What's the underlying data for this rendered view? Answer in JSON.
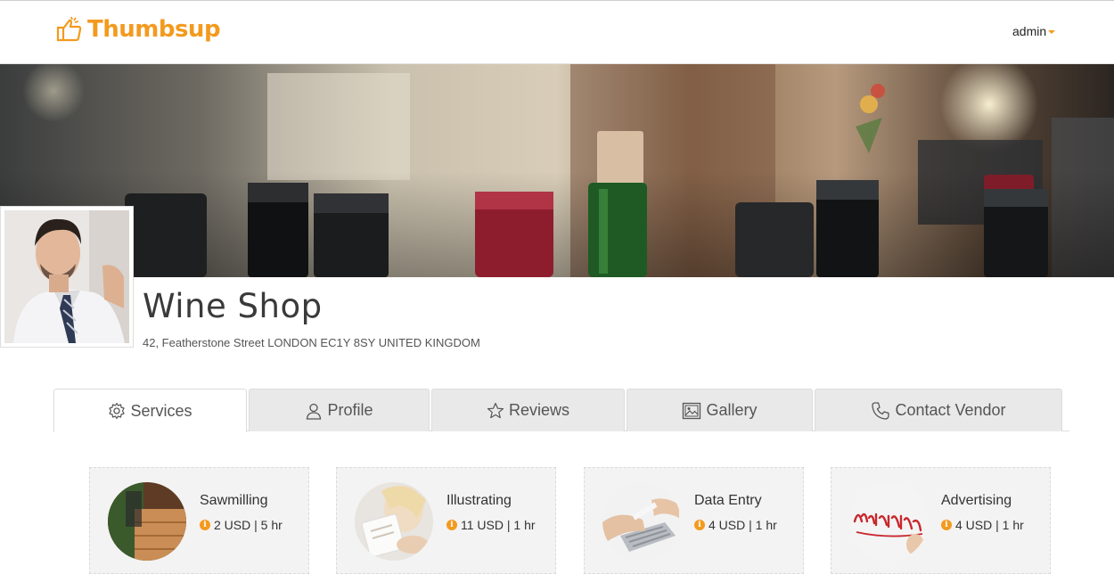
{
  "brand": {
    "name": "Thumbsup",
    "color": "#f39a1e"
  },
  "user_menu": {
    "label": "admin"
  },
  "shop": {
    "name": "Wine Shop",
    "address": "42, Featherstone Street LONDON EC1Y 8SY UNITED KINGDOM"
  },
  "tabs": [
    {
      "label": "Services",
      "icon": "gear-icon",
      "active": true
    },
    {
      "label": "Profile",
      "icon": "user-icon",
      "active": false
    },
    {
      "label": "Reviews",
      "icon": "star-icon",
      "active": false
    },
    {
      "label": "Gallery",
      "icon": "image-icon",
      "active": false
    },
    {
      "label": "Contact Vendor",
      "icon": "phone-icon",
      "active": false
    }
  ],
  "services": [
    {
      "title": "Sawmilling",
      "meta": "2 USD | 5 hr"
    },
    {
      "title": "Illustrating",
      "meta": "11 USD | 1 hr"
    },
    {
      "title": "Data Entry",
      "meta": "4 USD | 1 hr"
    },
    {
      "title": "Advertising",
      "meta": "4 USD | 1 hr"
    }
  ]
}
